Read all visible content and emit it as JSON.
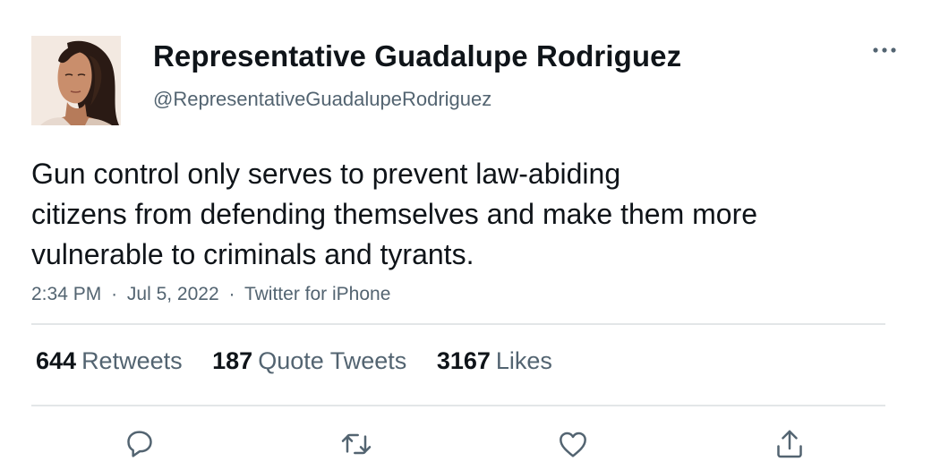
{
  "tweet": {
    "display_name": "Representative Guadalupe Rodriguez",
    "handle": "@RepresentativeGuadalupeRodriguez",
    "text_lines": [
      "Gun control only serves to prevent law-abiding",
      "citizens from defending themselves and make them more",
      "vulnerable to criminals and tyrants."
    ],
    "time": "2:34 PM",
    "date": "Jul 5, 2022",
    "separator": "·",
    "source": "Twitter for iPhone"
  },
  "stats": {
    "retweets_count": "644",
    "retweets_label": "Retweets",
    "quotes_count": "187",
    "quotes_label": "Quote Tweets",
    "likes_count": "3167",
    "likes_label": "Likes"
  },
  "actions": {
    "reply_icon": "reply-icon",
    "retweet_icon": "retweet-icon",
    "like_icon": "heart-icon",
    "share_icon": "share-icon",
    "more_icon": "more-horizontal-icon"
  },
  "colors": {
    "text_primary": "#0f1419",
    "text_secondary": "#536471",
    "divider": "#e3e6e8",
    "icon": "#536471"
  }
}
